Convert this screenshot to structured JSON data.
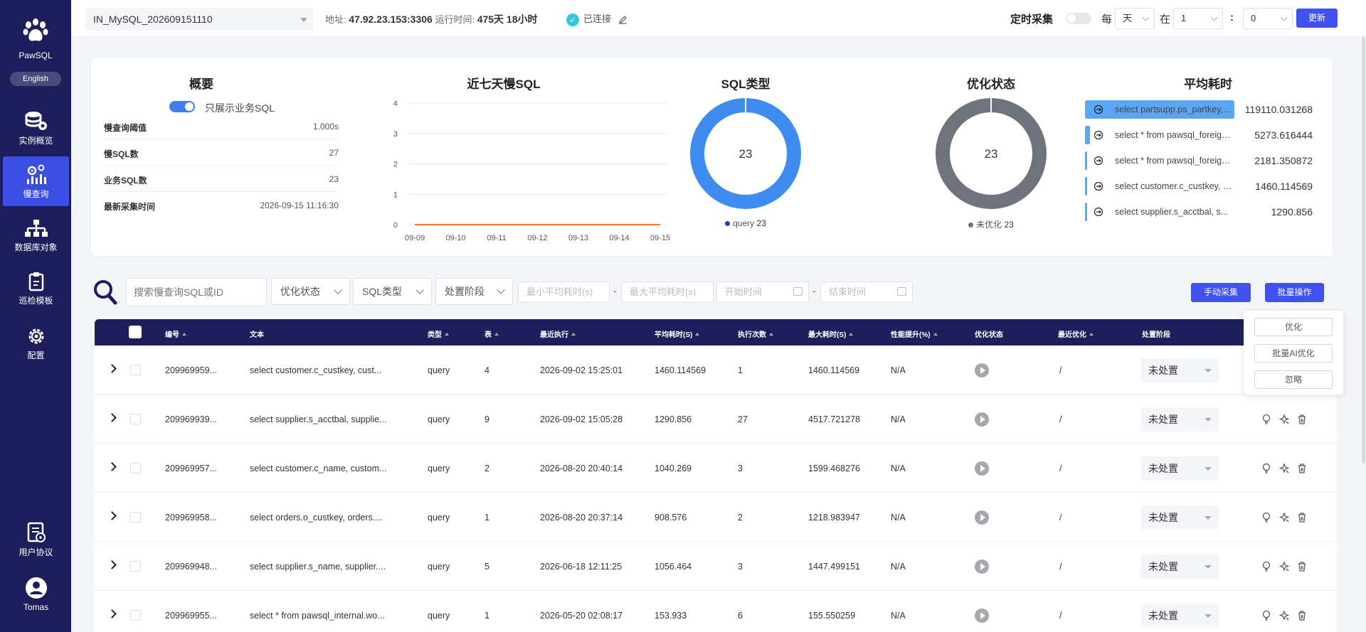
{
  "sidebar": {
    "brand": "PawSQL",
    "lang_button": "English",
    "items": [
      {
        "label": "实例概览",
        "icon": "database-stack-icon"
      },
      {
        "label": "慢查询",
        "icon": "slow-query-icon"
      },
      {
        "label": "数据库对象",
        "icon": "hierarchy-icon"
      },
      {
        "label": "巡检模板",
        "icon": "clipboard-icon"
      },
      {
        "label": "配置",
        "icon": "gear-icon"
      }
    ],
    "bottom_items": [
      {
        "label": "用户协议",
        "icon": "agreement-icon"
      },
      {
        "label": "Tomas",
        "icon": "user-avatar-icon"
      }
    ]
  },
  "topbar": {
    "instance": "IN_MySQL_202609151110",
    "address_label": "地址:",
    "address": "47.92.23.153:3306",
    "uptime_label": "运行时间:",
    "uptime": "475天 18小时",
    "status": "已连接",
    "schedule_label": "定时采集",
    "every_label": "每",
    "unit": "天",
    "at_label": "在",
    "hour": "1",
    "colon": ":",
    "minute": "0",
    "update_button": "更新"
  },
  "overview": {
    "title": "概要",
    "switch_label": "只展示业务SQL",
    "rows": [
      {
        "k": "慢查询阈值",
        "v": "1.000s"
      },
      {
        "k": "慢SQL数",
        "v": "27"
      },
      {
        "k": "业务SQL数",
        "v": "23"
      },
      {
        "k": "最新采集时间",
        "v": "2026-09-15 11:16:30"
      }
    ]
  },
  "chart_data": [
    {
      "type": "line",
      "title": "近七天慢SQL",
      "x": [
        "09-09",
        "09-10",
        "09-11",
        "09-12",
        "09-13",
        "09-14",
        "09-15"
      ],
      "series": [
        {
          "values": [
            0,
            0,
            0,
            0,
            0,
            0,
            0
          ],
          "color": "#f07a2a"
        }
      ],
      "yticks": [
        "0",
        "1",
        "2",
        "3",
        "4"
      ],
      "ylim": [
        0,
        4
      ],
      "grid": true
    },
    {
      "type": "pie",
      "title": "SQL类型",
      "center_text": "23",
      "slices": [
        {
          "name": "query",
          "value": 23,
          "color": "#3f8cf0"
        }
      ],
      "legend_value": "23"
    },
    {
      "type": "pie",
      "title": "优化状态",
      "center_text": "23",
      "slices": [
        {
          "name": "未优化",
          "value": 23,
          "color": "#6e737c"
        }
      ],
      "legend_value": "23"
    },
    {
      "type": "bar",
      "title": "平均耗时",
      "categories": [
        "select partsupp.ps_partkey, ...",
        "select * from pawsql_foreign...",
        "select * from pawsql_foreign...",
        "select customer.c_custkey, c...",
        "select supplier.s_acctbal, s..."
      ],
      "values": [
        119110.031268,
        5273.616444,
        2181.350872,
        1460.114569,
        1290.856
      ],
      "labels": [
        "119110.031268",
        "5273.616444",
        "2181.350872",
        "1460.114569",
        "1290.856"
      ],
      "color": "#5ba6f4"
    }
  ],
  "filters": {
    "search_placeholder": "搜索慢查询SQL或ID",
    "opt_status": "优化状态",
    "sql_type": "SQL类型",
    "stage": "处置阶段",
    "min_avg": "最小平均耗时(s)",
    "max_avg": "最大平均耗时(s)",
    "start_time": "开始时间",
    "end_time": "结束时间",
    "dash": "-",
    "manual_button": "手动采集",
    "batch_button": "批量操作"
  },
  "batch_menu": [
    "优化",
    "批量AI优化",
    "忽略"
  ],
  "table": {
    "columns": [
      "编号",
      "文本",
      "类型",
      "表",
      "最近执行",
      "平均耗时(S)",
      "执行次数",
      "最大耗时(S)",
      "性能提升(%)",
      "优化状态",
      "最近优化",
      "处置阶段"
    ],
    "rows": [
      {
        "id": "209969959...",
        "text": "select customer.c_custkey, cust...",
        "type": "query",
        "tables": "4",
        "last_exec": "2026-09-02 15:25:01",
        "avg": "1460.114569",
        "count": "1",
        "max": "1460.114569",
        "perf": "N/A",
        "last_opt": "/",
        "stage": "未处置"
      },
      {
        "id": "209969939...",
        "text": "select supplier.s_acctbal, supplie...",
        "type": "query",
        "tables": "9",
        "last_exec": "2026-09-02 15:05:28",
        "avg": "1290.856",
        "count": "27",
        "max": "4517.721278",
        "perf": "N/A",
        "last_opt": "/",
        "stage": "未处置"
      },
      {
        "id": "209969957...",
        "text": "select customer.c_name, custom...",
        "type": "query",
        "tables": "2",
        "last_exec": "2026-08-20 20:40:14",
        "avg": "1040.269",
        "count": "3",
        "max": "1599.468276",
        "perf": "N/A",
        "last_opt": "/",
        "stage": "未处置"
      },
      {
        "id": "209969958...",
        "text": "select orders.o_custkey, orders....",
        "type": "query",
        "tables": "1",
        "last_exec": "2026-08-20 20:37:14",
        "avg": "908.576",
        "count": "2",
        "max": "1218.983947",
        "perf": "N/A",
        "last_opt": "/",
        "stage": "未处置"
      },
      {
        "id": "209969948...",
        "text": "select supplier.s_name, supplier....",
        "type": "query",
        "tables": "5",
        "last_exec": "2026-06-18 12:11:25",
        "avg": "1056.464",
        "count": "3",
        "max": "1447.499151",
        "perf": "N/A",
        "last_opt": "/",
        "stage": "未处置"
      },
      {
        "id": "209969955...",
        "text": "select * from pawsql_internal.wo...",
        "type": "query",
        "tables": "1",
        "last_exec": "2026-05-20 02:08:17",
        "avg": "153.933",
        "count": "6",
        "max": "155.550259",
        "perf": "N/A",
        "last_opt": "/",
        "stage": "未处置"
      }
    ]
  },
  "colors": {
    "sidebar": "#1f1e5c",
    "accent": "#3f51f0",
    "active_nav": "#3a4ee6"
  }
}
